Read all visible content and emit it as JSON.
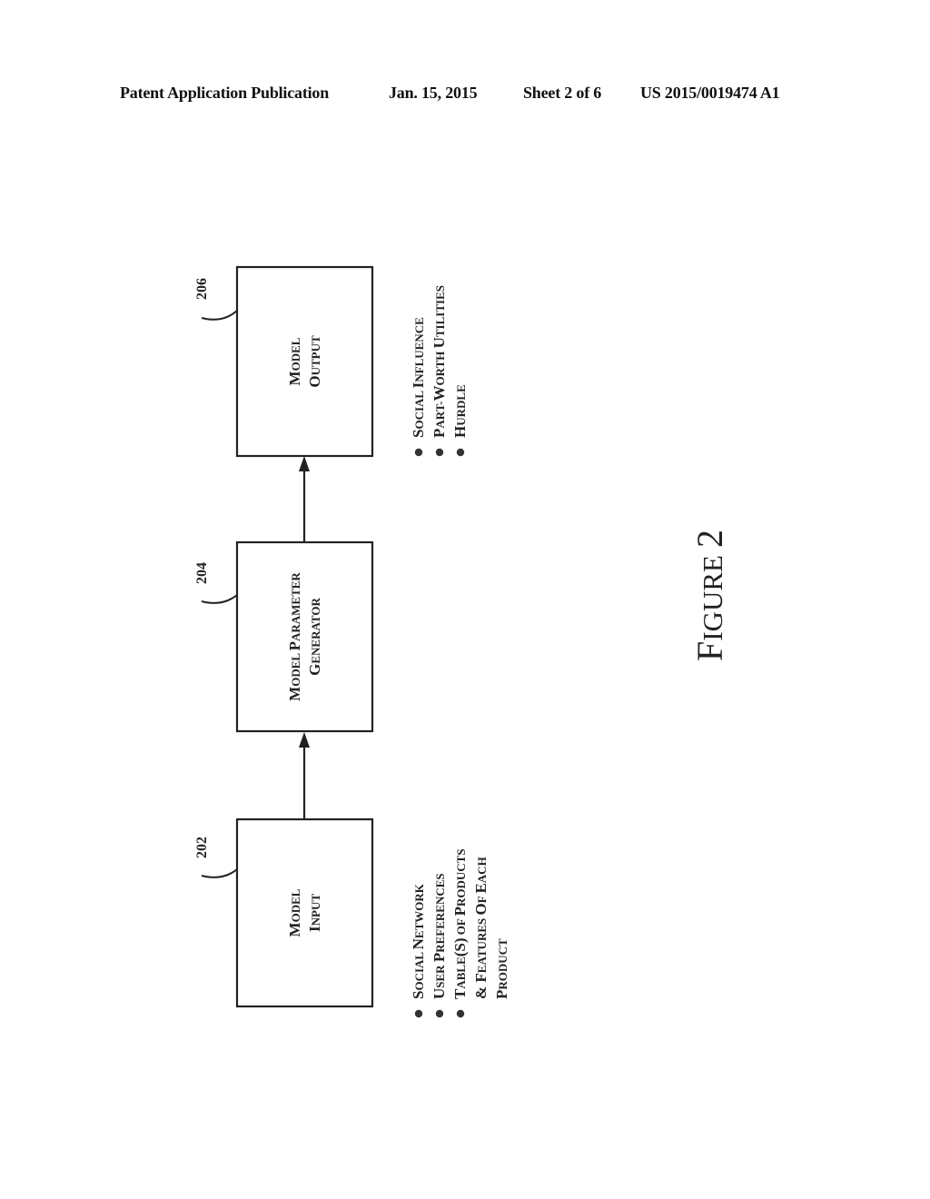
{
  "header": {
    "publication": "Patent Application Publication",
    "date": "Jan. 15, 2015",
    "sheet": "Sheet 2 of 6",
    "number": "US 2015/0019474 A1"
  },
  "figure": {
    "label_first": "F",
    "label_rest": "IGURE",
    "label_num": "2"
  },
  "blocks": [
    {
      "ref": "202",
      "lines": [
        [
          {
            "c": "M",
            "s": "ODEL"
          }
        ],
        [
          {
            "c": "I",
            "s": "NPUT"
          }
        ]
      ],
      "bullets": [
        [
          [
            {
              "c": "S",
              "s": "OCIAL "
            },
            {
              "c": "N",
              "s": "ETWORK"
            }
          ]
        ],
        [
          [
            {
              "c": "U",
              "s": "SER "
            },
            {
              "c": "P",
              "s": "REFERENCES"
            }
          ]
        ],
        [
          [
            {
              "c": "T",
              "s": "ABLE"
            },
            {
              "c": "(S)",
              "s": ""
            },
            {
              "c": "",
              "s": " OF "
            },
            {
              "c": "P",
              "s": "RODUCTS"
            }
          ],
          [
            {
              "c": "& F",
              "s": "EATURES "
            },
            {
              "c": "O",
              "s": "F "
            },
            {
              "c": "E",
              "s": "ACH"
            }
          ],
          [
            {
              "c": "P",
              "s": "RODUCT"
            }
          ]
        ]
      ]
    },
    {
      "ref": "204",
      "lines": [
        [
          {
            "c": "M",
            "s": "ODEL "
          },
          {
            "c": "P",
            "s": "ARAMETER"
          }
        ],
        [
          {
            "c": "G",
            "s": "ENERATOR"
          }
        ]
      ],
      "bullets": []
    },
    {
      "ref": "206",
      "lines": [
        [
          {
            "c": "M",
            "s": "ODEL"
          }
        ],
        [
          {
            "c": "O",
            "s": "UTPUT"
          }
        ]
      ],
      "bullets": [
        [
          [
            {
              "c": "S",
              "s": "OCIAL "
            },
            {
              "c": "I",
              "s": "NFLUENCE"
            }
          ]
        ],
        [
          [
            {
              "c": "P",
              "s": "ART-"
            },
            {
              "c": "W",
              "s": "ORTH "
            },
            {
              "c": "U",
              "s": "TILITIES"
            }
          ]
        ],
        [
          [
            {
              "c": "H",
              "s": "URDLE"
            }
          ]
        ]
      ]
    }
  ]
}
